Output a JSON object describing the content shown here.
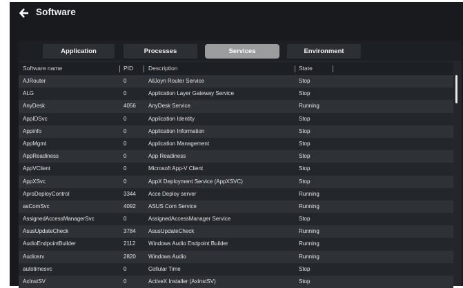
{
  "header": {
    "title": "Software",
    "back_icon": "arrow-left-icon"
  },
  "tabs": [
    {
      "label": "Application",
      "active": false
    },
    {
      "label": "Processes",
      "active": false
    },
    {
      "label": "Services",
      "active": true
    },
    {
      "label": "Environment",
      "active": false
    }
  ],
  "table": {
    "columns": [
      "Software name",
      "PID",
      "Description",
      "State"
    ],
    "rows": [
      {
        "name": "AJRouter",
        "pid": "0",
        "description": "AllJoyn Router Service",
        "state": "Stop"
      },
      {
        "name": "ALG",
        "pid": "0",
        "description": "Application Layer Gateway Service",
        "state": "Stop"
      },
      {
        "name": "AnyDesk",
        "pid": "4056",
        "description": "AnyDesk Service",
        "state": "Running"
      },
      {
        "name": "AppIDSvc",
        "pid": "0",
        "description": "Application Identity",
        "state": "Stop"
      },
      {
        "name": "Appinfo",
        "pid": "0",
        "description": "Application Information",
        "state": "Stop"
      },
      {
        "name": "AppMgmt",
        "pid": "0",
        "description": "Application Management",
        "state": "Stop"
      },
      {
        "name": "AppReadiness",
        "pid": "0",
        "description": "App Readiness",
        "state": "Stop"
      },
      {
        "name": "AppVClient",
        "pid": "0",
        "description": "Microsoft App-V Client",
        "state": "Stop"
      },
      {
        "name": "AppXSvc",
        "pid": "0",
        "description": "AppX Deployment Service (AppXSVC)",
        "state": "Stop"
      },
      {
        "name": "AproDeployControl",
        "pid": "3344",
        "description": "Acce Deploy server",
        "state": "Running"
      },
      {
        "name": "asComSvc",
        "pid": "4092",
        "description": "ASUS Com Service",
        "state": "Running"
      },
      {
        "name": "AssignedAccessManagerSvc",
        "pid": "0",
        "description": "AssignedAccessManager Service",
        "state": "Stop"
      },
      {
        "name": "AsusUpdateCheck",
        "pid": "3784",
        "description": "AsusUpdateCheck",
        "state": "Running"
      },
      {
        "name": "AudioEndpointBuilder",
        "pid": "2112",
        "description": "Windows Audio Endpoint Builder",
        "state": "Running"
      },
      {
        "name": "Audiosrv",
        "pid": "2820",
        "description": "Windows Audio",
        "state": "Running"
      },
      {
        "name": "autotimesvc",
        "pid": "0",
        "description": "Cellular Time",
        "state": "Stop"
      },
      {
        "name": "AxInstSV",
        "pid": "0",
        "description": "ActiveX Installer (AxInstSV)",
        "state": "Stop"
      }
    ]
  }
}
